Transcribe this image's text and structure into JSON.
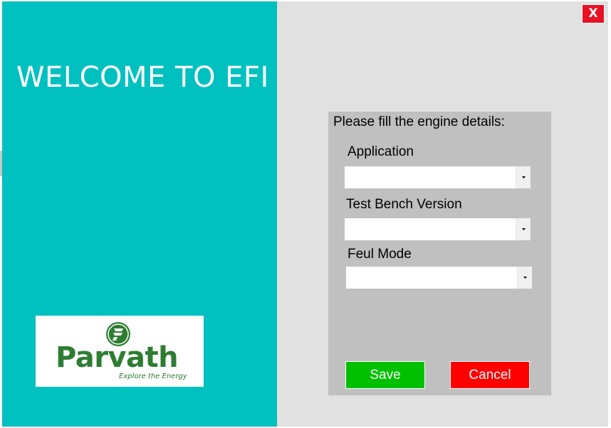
{
  "welcome": {
    "title": "WELCOME TO EFI"
  },
  "logo": {
    "name": "Parvath",
    "tagline": "Explore the Energy",
    "color": "#2e7d32"
  },
  "window": {
    "close_label": "X"
  },
  "form": {
    "heading": "Please fill the engine details:",
    "fields": [
      {
        "label": "Application",
        "value": ""
      },
      {
        "label": "Test Bench Version",
        "value": ""
      },
      {
        "label": "Feul Mode",
        "value": ""
      }
    ],
    "save_label": "Save",
    "cancel_label": "Cancel"
  },
  "colors": {
    "left_panel": "#00c0c0",
    "right_panel": "#e1e1e1",
    "form_panel": "#c0c0c0",
    "save": "#00c000",
    "cancel": "#ff0000",
    "close": "#e81123"
  }
}
